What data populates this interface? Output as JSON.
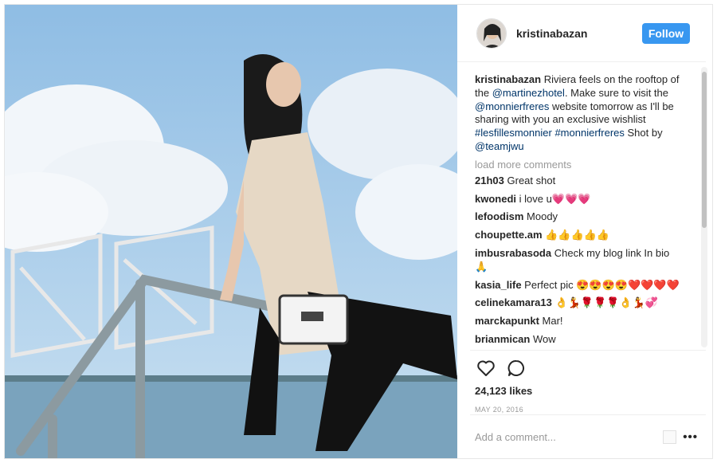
{
  "post": {
    "username": "kristinabazan",
    "follow_label": "Follow",
    "caption": {
      "author": "kristinabazan",
      "t1": " Riviera feels on the rooftop of the ",
      "m1": "@martinezhotel",
      "t2": ". Make sure to visit the ",
      "m2": "@monnierfreres",
      "t3": " website tomorrow as I'll be sharing with you an exclusive wishlist ",
      "h1": "#lesfillesmonnier",
      "t4": " ",
      "h2": "#monnierfreres",
      "t5": " Shot by ",
      "m3": "@teamjwu"
    },
    "load_more": "load more comments",
    "comments": [
      {
        "user": "21h03",
        "text": "Great shot"
      },
      {
        "user": "kwonedi",
        "text": "i love u💗💗💗"
      },
      {
        "user": "lefoodism",
        "text": "Moody"
      },
      {
        "user": "choupette.am",
        "text": "👍👍👍👍👍"
      },
      {
        "user": "imbusrabasoda",
        "text": "Check my blog link In bio 🙏"
      },
      {
        "user": "kasia_life",
        "text": "Perfect pic 😍😍😍😍❤️❤️❤️❤️"
      },
      {
        "user": "celinekamara13",
        "text": "👌💃🌹🌹🌹👌💃💞"
      },
      {
        "user": "marckapunkt",
        "text": "Mar!"
      },
      {
        "user": "brianmican",
        "text": "Wow"
      }
    ],
    "likes": "24,123 likes",
    "date": "MAY 20, 2016",
    "comment_placeholder": "Add a comment...",
    "more_label": "•••",
    "icons": {
      "like": "heart-icon",
      "comment": "comment-bubble-icon"
    },
    "colors": {
      "follow_bg": "#3897f0",
      "link": "#003569",
      "muted": "#999999"
    }
  }
}
